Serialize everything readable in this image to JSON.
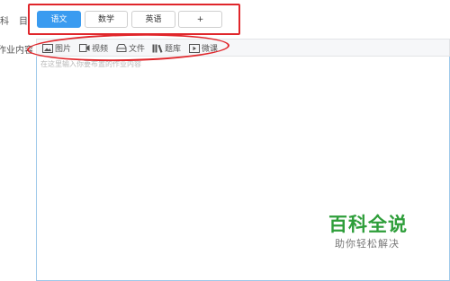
{
  "left_panel": {
    "label_1": "科",
    "label_2": "目",
    "label_3": "作业内容"
  },
  "subject_tabs": [
    {
      "label": "语文",
      "active": true
    },
    {
      "label": "数学",
      "active": false
    },
    {
      "label": "英语",
      "active": false
    },
    {
      "label": "+",
      "active": false
    }
  ],
  "toolbar": {
    "items": [
      {
        "label": "图片",
        "icon": "image-icon"
      },
      {
        "label": "视频",
        "icon": "video-icon"
      },
      {
        "label": "文件",
        "icon": "file-icon"
      },
      {
        "label": "题库",
        "icon": "question-bank-icon"
      },
      {
        "label": "微课",
        "icon": "micro-lesson-icon"
      }
    ]
  },
  "editor": {
    "placeholder": "在这里输入你要布置的作业内容"
  },
  "watermark": {
    "title": "百科全说",
    "subtitle": "助你轻松解决"
  },
  "colors": {
    "accent": "#3a9bf0",
    "annotation": "#e0262b",
    "watermark": "#2e9e3a"
  }
}
